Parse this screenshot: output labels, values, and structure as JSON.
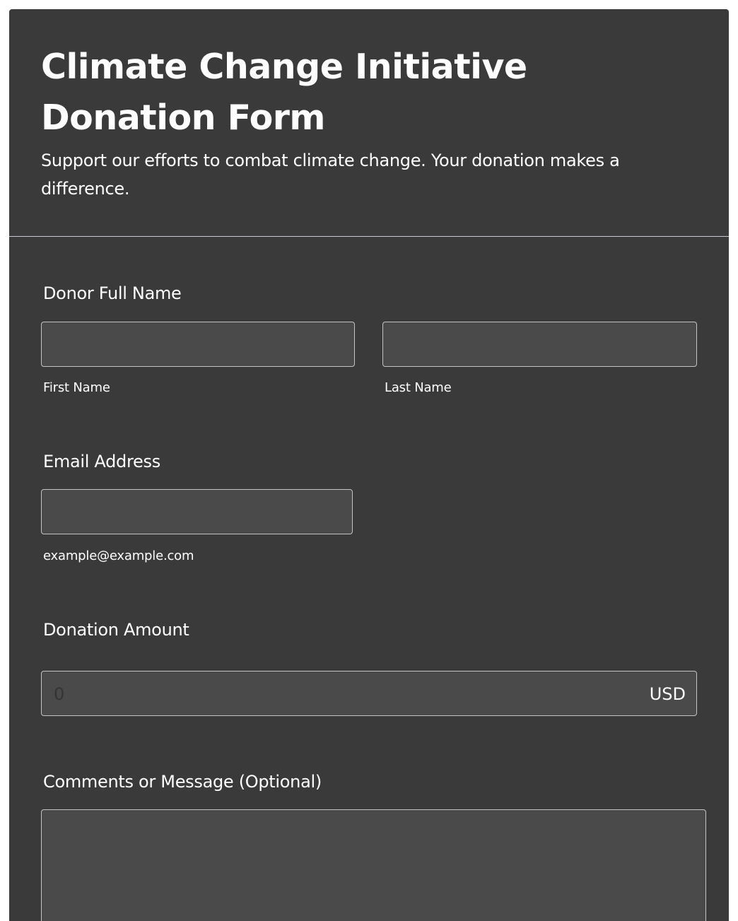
{
  "form": {
    "title": "Climate Change Initiative Donation Form",
    "subtitle": "Support our efforts to combat climate change. Your donation makes a difference."
  },
  "fields": {
    "donor_name": {
      "label": "Donor Full Name",
      "first_sublabel": "First Name",
      "last_sublabel": "Last Name",
      "first_value": "",
      "last_value": ""
    },
    "email": {
      "label": "Email Address",
      "sublabel": "example@example.com",
      "value": ""
    },
    "donation": {
      "label": "Donation Amount",
      "placeholder": "0",
      "currency": "USD"
    },
    "comments": {
      "label": "Comments or Message (Optional)",
      "value": ""
    }
  },
  "colors": {
    "card_background": "#3a3a3a",
    "input_background": "#4a4a4a",
    "input_border": "#c4c4c4",
    "text": "#ffffff"
  }
}
